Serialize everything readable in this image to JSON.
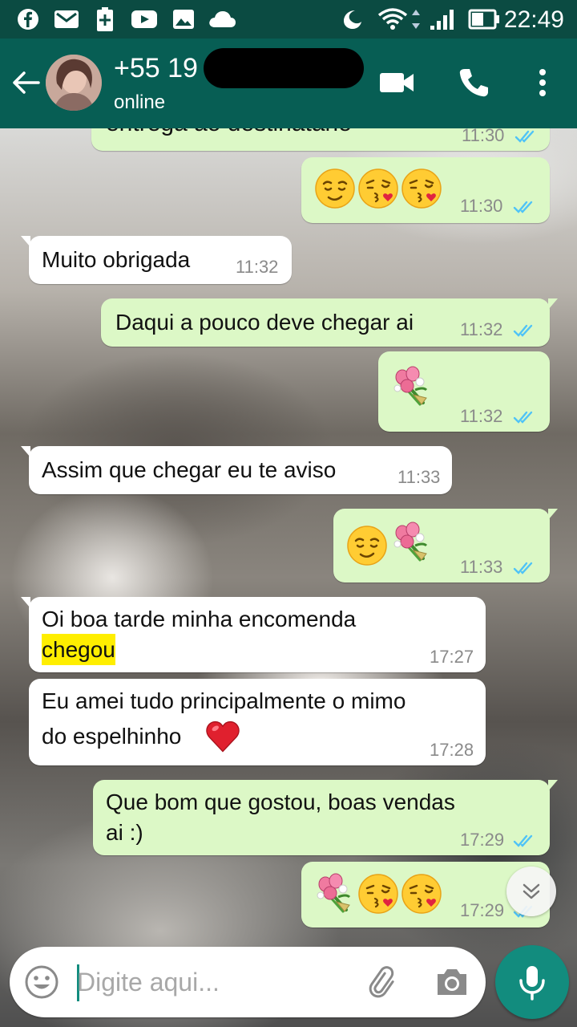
{
  "status_bar": {
    "time": "22:49",
    "icons": [
      "facebook-icon",
      "gmail-icon",
      "battery-plus-icon",
      "youtube-icon",
      "gallery-icon",
      "cloud-icon",
      "moon-icon",
      "wifi-icon",
      "signal-icon",
      "battery-icon"
    ]
  },
  "header": {
    "contact_name": "+55 19",
    "status": "online",
    "icons": [
      "back-arrow-icon",
      "video-call-icon",
      "phone-icon",
      "more-vert-icon"
    ]
  },
  "messages": [
    {
      "dir": "out",
      "text": "entrega ao destinatário",
      "time": "11:30",
      "read": true
    },
    {
      "dir": "out",
      "emojis": [
        "relieved",
        "kiss-heart",
        "kiss-heart"
      ],
      "time": "11:30",
      "read": true
    },
    {
      "dir": "in",
      "text": "Muito obrigada",
      "time": "11:32"
    },
    {
      "dir": "out",
      "text": "Daqui a pouco deve chegar ai",
      "time": "11:32",
      "read": true
    },
    {
      "dir": "out",
      "emojis": [
        "bouquet"
      ],
      "time": "11:32",
      "read": true
    },
    {
      "dir": "in",
      "text": "Assim que chegar eu te aviso",
      "time": "11:33"
    },
    {
      "dir": "out",
      "emojis": [
        "relieved",
        "bouquet"
      ],
      "time": "11:33",
      "read": true
    },
    {
      "dir": "in",
      "line1": "Oi boa tarde minha encomenda",
      "line2": "chegou",
      "time": "17:27"
    },
    {
      "dir": "in",
      "line1": "Eu amei tudo principalmente o mimo",
      "line2": "do espelhinho",
      "emojis": [
        "red-heart"
      ],
      "time": "17:28"
    },
    {
      "dir": "out",
      "line1": "Que bom que gostou, boas vendas",
      "line2": "ai :)",
      "time": "17:29",
      "read": true
    },
    {
      "dir": "out",
      "emojis": [
        "bouquet",
        "kiss-heart",
        "kiss-heart"
      ],
      "time": "17:29",
      "read": true
    }
  ],
  "composer": {
    "placeholder": "Digite aqui...",
    "icons": [
      "emoji-icon",
      "attach-icon",
      "camera-icon",
      "mic-icon",
      "scroll-down-icon"
    ]
  },
  "colors": {
    "status_bar": "#0b4b42",
    "header": "#075e54",
    "outgoing_bubble": "#dcf8c6",
    "incoming_bubble": "#ffffff",
    "read_ticks": "#4fc3f7",
    "mic_button": "#128c7e",
    "highlight": "#ffee00"
  }
}
